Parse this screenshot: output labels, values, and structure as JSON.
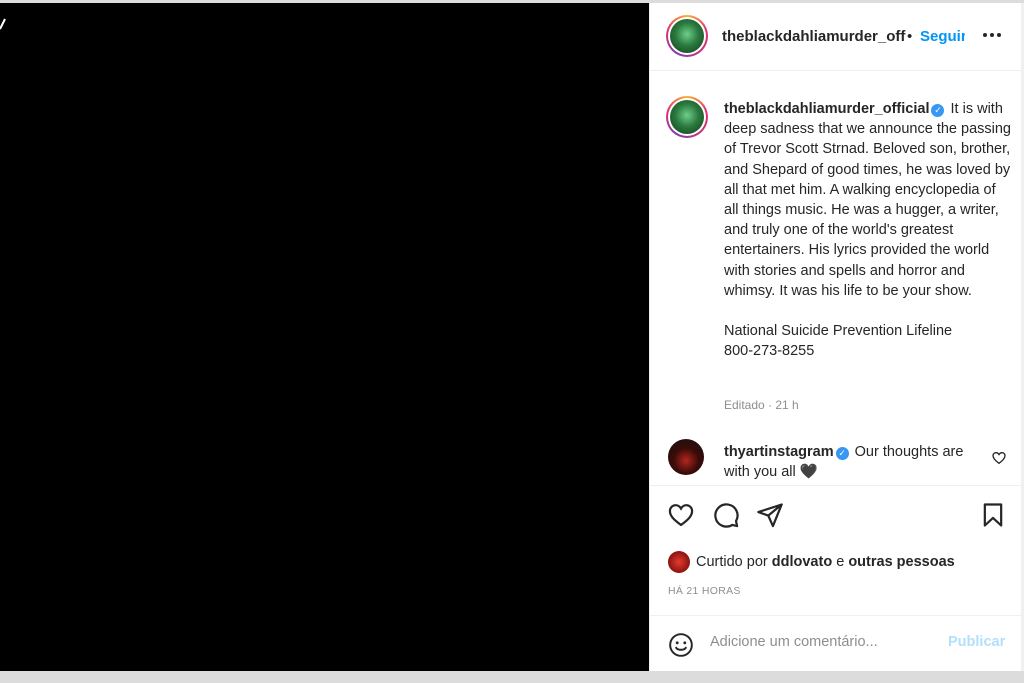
{
  "post": {
    "username_truncated": "theblackdahliamurder_off",
    "header_dot": "•",
    "follow_label": "Seguir",
    "more_icon": "more-horizontal-icon"
  },
  "caption": {
    "username": "theblackdahliamurder_official",
    "verified": true,
    "text": "It is with deep sadness that we announce the passing of Trevor Scott Strnad. Beloved son, brother, and Shepard of good times, he was loved by all that met him. A walking encyclopedia of all things music. He was a hugger, a writer, and truly one of the world's greatest entertainers. His lyrics provided the world with stories and spells and horror and whimsy. It was his life to be your show.",
    "line2": "National Suicide Prevention Lifeline",
    "line3": "800-273-8255",
    "meta": "Editado · 21 h"
  },
  "comment": {
    "username": "thyartinstagram",
    "verified": true,
    "text": "Our thoughts are with you all",
    "emoji": "🖤"
  },
  "actions": {
    "like_icon": "heart-icon",
    "comment_icon": "comment-icon",
    "share_icon": "share-icon",
    "save_icon": "bookmark-icon"
  },
  "likes": {
    "prefix": "Curtido por",
    "user": "ddlovato",
    "middle": "e",
    "suffix": "outras pessoas"
  },
  "timestamp": "HÁ 21 HORAS",
  "composer": {
    "placeholder": "Adicione um comentário...",
    "publish_label": "Publicar"
  },
  "colors": {
    "accent": "#0095f6",
    "publish_disabled": "#b2dffc",
    "verified": "#3897f0",
    "secondary_text": "#8e8e8e"
  }
}
